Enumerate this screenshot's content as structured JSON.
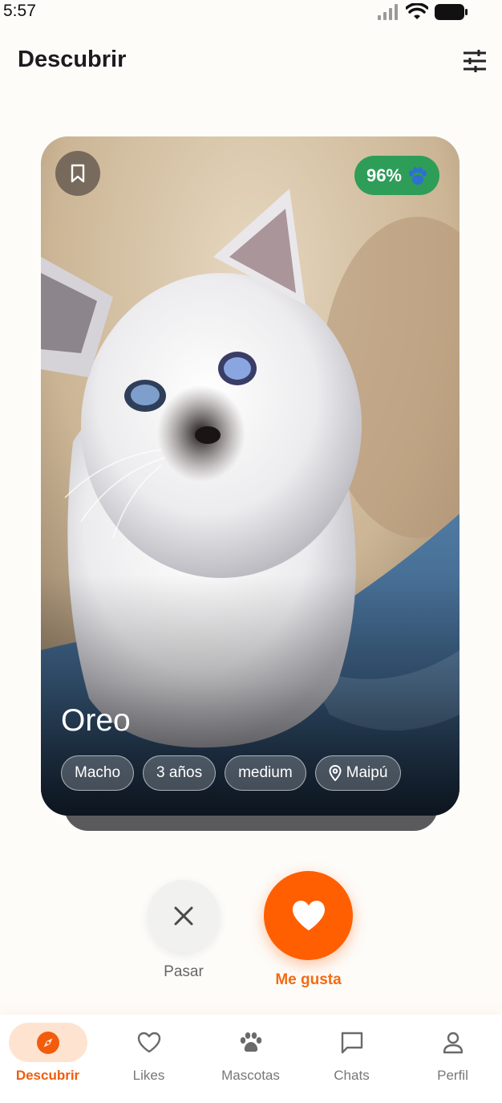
{
  "status_bar": {
    "time": "5:57"
  },
  "header": {
    "title": "Descubrir",
    "filter_icon": "tune-icon"
  },
  "card": {
    "pet_name": "Oreo",
    "match_percent": "96%",
    "match_icon": "paw-icon",
    "bookmark_icon": "bookmark-icon",
    "tags": [
      {
        "label": "Macho"
      },
      {
        "label": "3 años"
      },
      {
        "label": "medium"
      },
      {
        "label": "Maipú",
        "icon": "location-pin-icon"
      }
    ]
  },
  "actions": {
    "pass_label": "Pasar",
    "like_label": "Me gusta"
  },
  "nav": {
    "items": [
      {
        "label": "Descubrir",
        "icon": "compass-icon",
        "active": true
      },
      {
        "label": "Likes",
        "icon": "heart-icon",
        "active": false
      },
      {
        "label": "Mascotas",
        "icon": "paw-icon",
        "active": false
      },
      {
        "label": "Chats",
        "icon": "chat-icon",
        "active": false
      },
      {
        "label": "Perfil",
        "icon": "person-icon",
        "active": false
      }
    ]
  },
  "colors": {
    "accent": "#ff5f00",
    "match_badge": "#2e9d58",
    "nav_active_bg": "#ffe3d1",
    "background": "#fdfcf9"
  }
}
